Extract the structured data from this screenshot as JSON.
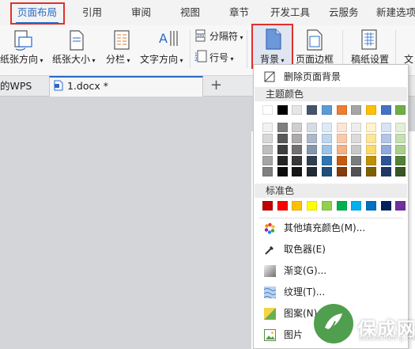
{
  "menu": {
    "tabs": [
      {
        "label": "页面布局",
        "active": true
      },
      {
        "label": "引用"
      },
      {
        "label": "审阅"
      },
      {
        "label": "视图"
      },
      {
        "label": "章节"
      },
      {
        "label": "开发工具"
      },
      {
        "label": "云服务"
      },
      {
        "label": "新建选项"
      }
    ]
  },
  "ribbon": {
    "orientation": "纸张方向",
    "size": "纸张大小",
    "columns": "分栏",
    "text_direction": "文字方向",
    "separator": "分隔符",
    "line_number": "行号",
    "background": "背景",
    "page_border": "页面边框",
    "manuscript": "稿纸设置",
    "truncated": "文"
  },
  "doc_tabs": {
    "prev": "的WPS",
    "active": "1.docx *",
    "add": "+"
  },
  "dropdown": {
    "remove_bg": "删除页面背景",
    "theme_header": "主题颜色",
    "standard_header": "标准色",
    "more_colors": "其他填充颜色(M)...",
    "picker": "取色器(E)",
    "gradient": "渐变(G)...",
    "texture": "纹理(T)...",
    "pattern": "图案(N)...",
    "picture": "图片"
  },
  "theme_colors": {
    "top_row": [
      "#ffffff",
      "#000000",
      "#e7e6e6",
      "#44546a",
      "#5b9bd5",
      "#ed7d31",
      "#a5a5a5",
      "#ffc000",
      "#4472c4",
      "#70ad47"
    ],
    "shades": [
      [
        "#f2f2f2",
        "#7f7f7f",
        "#d0cece",
        "#d6dce4",
        "#deebf6",
        "#fbe5d5",
        "#ededed",
        "#fff2cc",
        "#dae3f3",
        "#e2efd9"
      ],
      [
        "#d8d8d8",
        "#595959",
        "#aeabab",
        "#adb9ca",
        "#bdd7ee",
        "#f7cbac",
        "#dbdbdb",
        "#fee599",
        "#b4c6e7",
        "#c5e0b3"
      ],
      [
        "#bfbfbf",
        "#3f3f3f",
        "#757070",
        "#8496b0",
        "#9cc3e5",
        "#f4b183",
        "#c9c9c9",
        "#ffd965",
        "#8eaadb",
        "#a8d08d"
      ],
      [
        "#a5a5a5",
        "#262626",
        "#3a3838",
        "#323f4f",
        "#2e75b5",
        "#c55a11",
        "#7b7b7b",
        "#bf9000",
        "#2f5496",
        "#538135"
      ],
      [
        "#7f7f7f",
        "#0c0c0c",
        "#171616",
        "#222a35",
        "#1e4e79",
        "#833c0b",
        "#525252",
        "#7f6000",
        "#1f3864",
        "#375623"
      ]
    ]
  },
  "standard_colors": [
    "#c00000",
    "#ff0000",
    "#ffc000",
    "#ffff00",
    "#92d050",
    "#00b050",
    "#00b0f0",
    "#0070c0",
    "#002060",
    "#7030a0"
  ],
  "watermark": {
    "brand": "保成网",
    "url": "zsbaochen g.com"
  },
  "colors": {
    "accent": "#2a6ac8",
    "highlight_border": "#e0302a"
  }
}
